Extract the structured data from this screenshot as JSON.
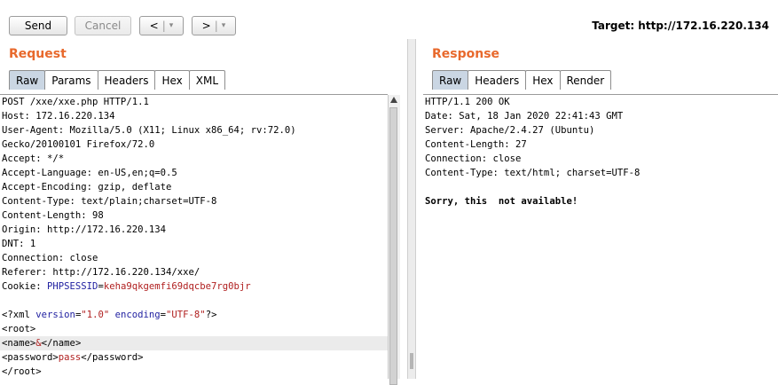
{
  "toolbar": {
    "send_label": "Send",
    "cancel_label": "Cancel",
    "back_symbol": "<",
    "forward_symbol": ">",
    "dropdown_symbol": "▾",
    "target_label": "Target: http://172.16.220.134"
  },
  "request": {
    "title": "Request",
    "tabs": [
      "Raw",
      "Params",
      "Headers",
      "Hex",
      "XML"
    ],
    "active_tab": "Raw",
    "lines": [
      "POST /xxe/xxe.php HTTP/1.1",
      "Host: 172.16.220.134",
      "User-Agent: Mozilla/5.0 (X11; Linux x86_64; rv:72.0)",
      "Gecko/20100101 Firefox/72.0",
      "Accept: */*",
      "Accept-Language: en-US,en;q=0.5",
      "Accept-Encoding: gzip, deflate",
      "Content-Type: text/plain;charset=UTF-8",
      "Content-Length: 98",
      "Origin: http://172.16.220.134",
      "DNT: 1",
      "Connection: close",
      "Referer: http://172.16.220.134/xxe/"
    ],
    "cookie_prefix": "Cookie: ",
    "cookie_name": "PHPSESSID",
    "cookie_eq": "=",
    "cookie_value": "keha9qkgemfi69dqcbe7rg0bjr",
    "xml_decl": {
      "open": "<?xml ",
      "attr1": "version",
      "eq1": "=",
      "val1": "\"1.0\"",
      "space": " ",
      "attr2": "encoding",
      "eq2": "=",
      "val2": "\"UTF-8\"",
      "close": "?>"
    },
    "root_open": "<root>",
    "name_open": "<name>",
    "name_value": "&",
    "name_close": "</name>",
    "password_open": "<password>",
    "password_value": "pass",
    "password_close": "</password>",
    "root_close": "</root>"
  },
  "response": {
    "title": "Response",
    "tabs": [
      "Raw",
      "Headers",
      "Hex",
      "Render"
    ],
    "active_tab": "Raw",
    "lines": [
      "HTTP/1.1 200 OK",
      "Date: Sat, 18 Jan 2020 22:41:43 GMT",
      "Server: Apache/2.4.27 (Ubuntu)",
      "Content-Length: 27",
      "Connection: close",
      "Content-Type: text/html; charset=UTF-8"
    ],
    "body": "Sorry, this  not available!"
  },
  "colors": {
    "section_title": "#e8692c",
    "active_tab": "#cad6e3",
    "xml_attr": "#1f1fa0",
    "xml_value": "#b01f1f"
  }
}
